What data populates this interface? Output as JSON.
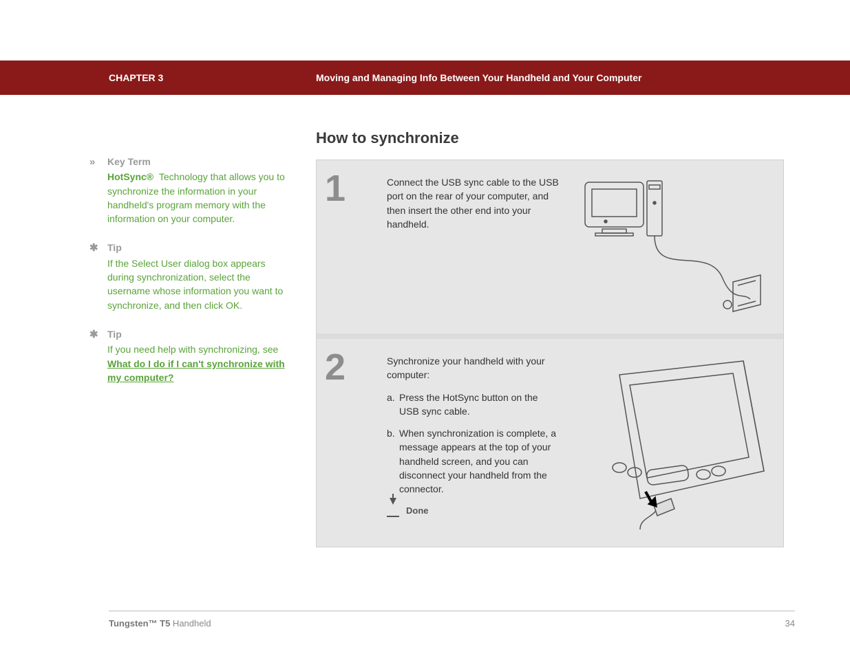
{
  "header": {
    "chapter": "CHAPTER 3",
    "title": "Moving and Managing Info Between Your Handheld and Your Computer"
  },
  "sidebar": {
    "keyterm": {
      "head": "Key Term",
      "term": "HotSync®",
      "body": "Technology that allows you to synchronize the information in your handheld's program memory with the information on your computer."
    },
    "tip1": {
      "head": "Tip",
      "body": "If the Select User dialog box appears during synchronization, select the username whose information you want to synchronize, and then click OK."
    },
    "tip2": {
      "head": "Tip",
      "lead": "If you need help with synchronizing, see ",
      "link": "What do I do if I can't synchronize with my computer?"
    }
  },
  "main": {
    "heading": "How to synchronize",
    "step1": {
      "num": "1",
      "text": "Connect the USB sync cable to the USB port on the rear of your computer, and then insert the other end into your handheld."
    },
    "step2": {
      "num": "2",
      "intro": "Synchronize your handheld with your computer:",
      "a_marker": "a.",
      "a_text": "Press the HotSync button on the USB sync cable.",
      "b_marker": "b.",
      "b_text": "When synchronization is complete, a message appears at the top of your handheld screen, and you can disconnect your handheld from the connector.",
      "done": "Done"
    }
  },
  "footer": {
    "product_bold": "Tungsten™ T5",
    "product_rest": " Handheld",
    "page": "34"
  }
}
